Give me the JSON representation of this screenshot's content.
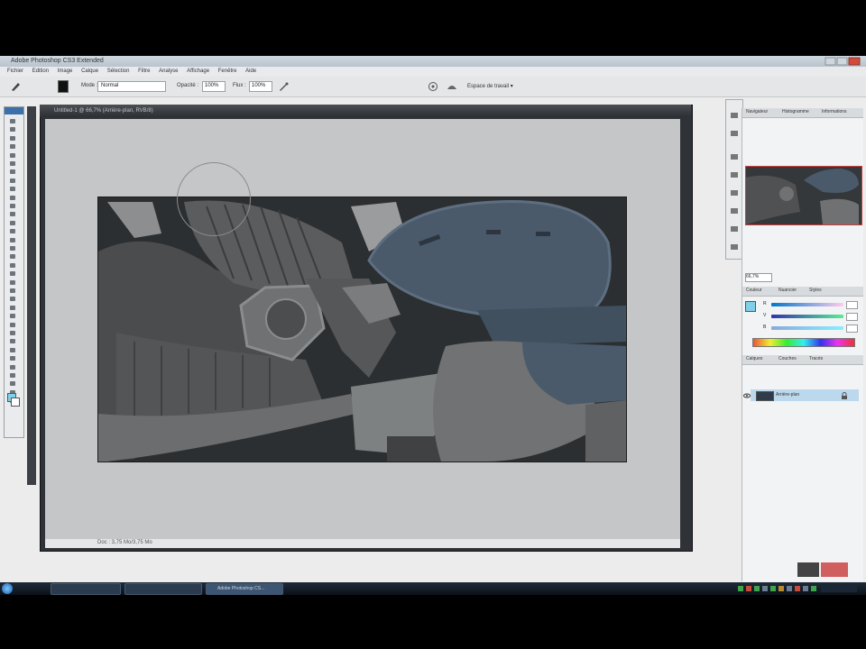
{
  "window": {
    "title": "Adobe Photoshop CS3 Extended"
  },
  "menu": [
    "Fichier",
    "Edition",
    "Image",
    "Calque",
    "Sélection",
    "Filtre",
    "Analyse",
    "Affichage",
    "Fenêtre",
    "Aide"
  ],
  "options": {
    "mode_label": "Mode :",
    "mode_value": "Normal",
    "opacity_label": "Opacité :",
    "opacity_value": "100%",
    "flow_label": "Flux :",
    "flow_value": "100%",
    "workspace": "Espace de travail ▾"
  },
  "document": {
    "title": "Untitled-1 @ 66,7% (Arrière-plan, RVB/8)",
    "status": "Doc : 3,75 Mo/3,75 Mo"
  },
  "panels": {
    "navigator_tabs": [
      "Navigateur",
      "Histogramme",
      "Informations"
    ],
    "zoom": "66,7%",
    "color_tabs": [
      "Couleur",
      "Nuancier",
      "Styles"
    ],
    "color_values": [
      "R",
      "V",
      "B"
    ],
    "layers_tabs": [
      "Calques",
      "Couches",
      "Tracés"
    ],
    "layer_name": "Arrière-plan"
  },
  "taskbar": {
    "items": [
      "",
      "",
      "Adobe Photoshop CS..."
    ]
  },
  "colors": {
    "accent": "#7fd0e8",
    "nav_frame": "#d03a3a"
  }
}
